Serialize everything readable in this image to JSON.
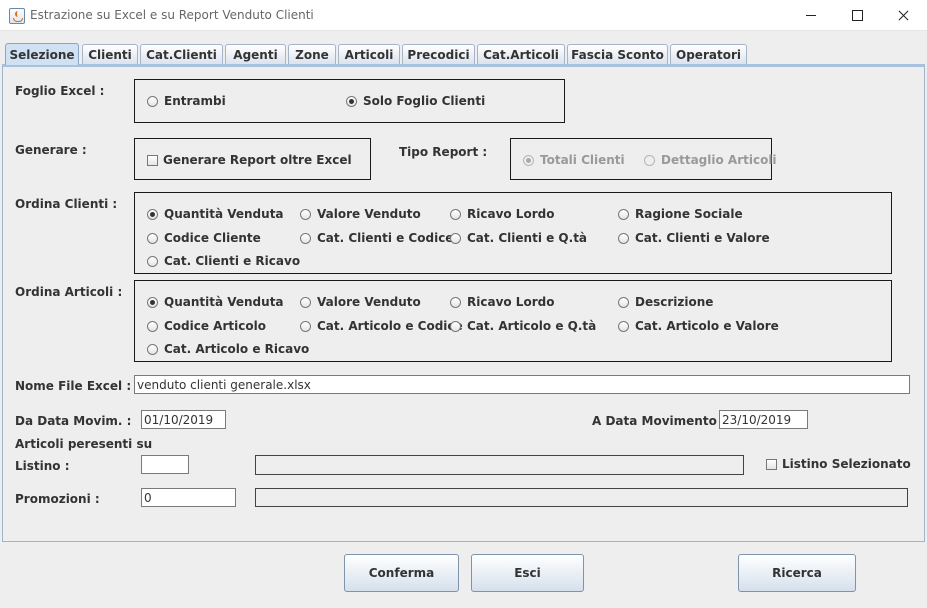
{
  "window": {
    "title": "Estrazione su Excel e su Report Venduto Clienti"
  },
  "tabs": [
    "Selezione",
    "Clienti",
    "Cat.Clienti",
    "Agenti",
    "Zone",
    "Articoli",
    "Precodici",
    "Cat.Articoli",
    "Fascia Sconto",
    "Operatori"
  ],
  "active_tab": "Selezione",
  "foglio_excel": {
    "label": "Foglio Excel  :",
    "options": [
      "Entrambi",
      "Solo Foglio Clienti"
    ],
    "selected": "Solo Foglio Clienti"
  },
  "generare": {
    "label": "Generare :",
    "checkbox_label": "Generare Report oltre Excel",
    "checked": false
  },
  "tipo_report": {
    "label": "Tipo Report :",
    "options": [
      "Totali Clienti",
      "Dettaglio Articoli"
    ],
    "selected": "Totali Clienti",
    "enabled": false
  },
  "ordina_clienti": {
    "label": "Ordina  Clienti :",
    "options": [
      "Quantità Venduta",
      "Valore Venduto",
      "Ricavo Lordo",
      "Ragione Sociale",
      "Codice Cliente",
      "Cat. Clienti e Codice",
      "Cat. Clienti e Q.tà",
      "Cat. Clienti e Valore",
      "Cat. Clienti e Ricavo"
    ],
    "selected": "Quantità Venduta"
  },
  "ordina_articoli": {
    "label": "Ordina  Articoli :",
    "options": [
      "Quantità Venduta",
      "Valore Venduto",
      "Ricavo Lordo",
      "Descrizione",
      "Codice Articolo",
      "Cat. Articolo e Codice",
      "Cat. Articolo e Q.tà",
      "Cat. Articolo e Valore",
      "Cat. Articolo e Ricavo"
    ],
    "selected": "Quantità Venduta"
  },
  "nome_file": {
    "label": "Nome File Excel :",
    "value": "venduto clienti generale.xlsx"
  },
  "da_data": {
    "label": "Da Data Movim. :",
    "value": "01/10/2019"
  },
  "a_data": {
    "label": "A  Data Movimento :",
    "value": "23/10/2019"
  },
  "articoli_presenti": {
    "label": "Articoli peresenti su"
  },
  "listino": {
    "label": "Listino :",
    "value": "",
    "description": "",
    "checkbox_label": "Listino Selezionato",
    "checked": false
  },
  "promozioni": {
    "label": "Promozioni :",
    "value": "0",
    "description": ""
  },
  "buttons": {
    "conferma": "Conferma",
    "esci": "Esci",
    "ricerca": "Ricerca"
  }
}
